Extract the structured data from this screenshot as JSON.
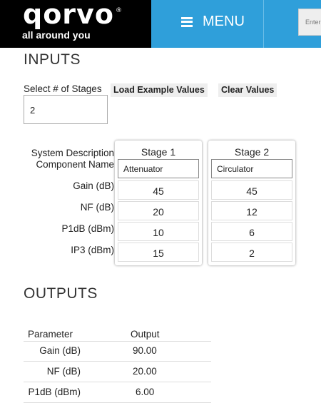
{
  "header": {
    "logo_text": "qorvo",
    "logo_mark": "®",
    "tagline": "all around you",
    "menu_label": "MENU",
    "search_placeholder": "Enter"
  },
  "inputs": {
    "heading": "INPUTS",
    "stages_label": "Select # of Stages",
    "stages_value": "2",
    "load_button": "Load Example Values",
    "clear_button": "Clear Values",
    "row_labels": {
      "system_description": "System Description",
      "component_name": "Component Name",
      "gain": "Gain (dB)",
      "nf": "NF (dB)",
      "p1db": "P1dB (dBm)",
      "ip3": "IP3 (dBm)"
    },
    "stages": [
      {
        "title": "Stage 1",
        "component": "Attenuator",
        "gain": "45",
        "nf": "20",
        "p1db": "10",
        "ip3": "15"
      },
      {
        "title": "Stage 2",
        "component": "Circulator",
        "gain": "45",
        "nf": "12",
        "p1db": "6",
        "ip3": "2"
      }
    ]
  },
  "outputs": {
    "heading": "OUTPUTS",
    "col_parameter": "Parameter",
    "col_output": "Output",
    "rows": [
      {
        "param": "Gain (dB)",
        "value": "90.00"
      },
      {
        "param": "NF (dB)",
        "value": "20.00"
      },
      {
        "param": "P1dB (dBm)",
        "value": "6.00"
      }
    ]
  }
}
